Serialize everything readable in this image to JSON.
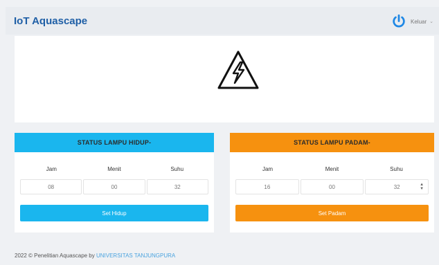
{
  "app": {
    "title": "IoT Aquascape"
  },
  "header": {
    "logout_label": "Keluar",
    "accent": "#1f88e5"
  },
  "banner": {
    "icon": "electric-warning-icon"
  },
  "card_on": {
    "title": "STATUS LAMPU HIDUP-",
    "color": "#1ab6ee",
    "labels": {
      "jam": "Jam",
      "menit": "Menit",
      "suhu": "Suhu"
    },
    "values": {
      "jam": "08",
      "menit": "00",
      "suhu": "32"
    },
    "button": "Set Hidup"
  },
  "card_off": {
    "title": "STATUS LAMPU PADAM-",
    "color": "#f6910f",
    "labels": {
      "jam": "Jam",
      "menit": "Menit",
      "suhu": "Suhu"
    },
    "values": {
      "jam": "16",
      "menit": "00",
      "suhu": "32"
    },
    "button": "Set Padam"
  },
  "footer": {
    "text": "2022 © Penelitian Aquascape by ",
    "link": "UNIVERSITAS TANJUNGPURA"
  }
}
